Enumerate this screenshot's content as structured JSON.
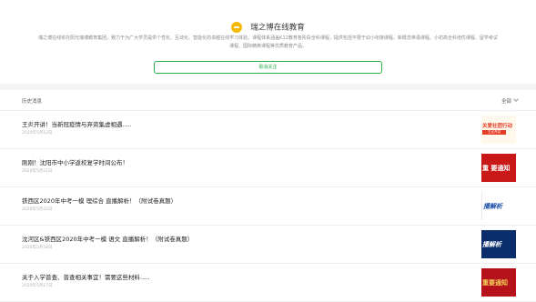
{
  "header": {
    "brand_icon": "bear-logo-icon",
    "brand_color": "#f5b90a",
    "brand_name": "瑞之博在线教育",
    "intro": "瑞之博在线依托阳光瑞博教育集团，致力于为广大学员提供个性化、互动化、智能化的卓越在线学习体验。课程体系涵盖K12教育各阶段全科课程，提供包括不限于幼小衔接课程、新概念英语课程、小初高全科培优课程、留学考试课程、国际精英课程等优质教育产品。",
    "follow_button": "取消关注",
    "accent_color": "#27b24b"
  },
  "history": {
    "title": "历史消息",
    "filter_label": "全部"
  },
  "articles": [
    {
      "title": "王炎开讲！当新冠疫情与弃资集虚相遇.....",
      "date": "2020年5月12日",
      "thumb_text": "关爱社团行动",
      "thumb_sub": "王炎开讲"
    },
    {
      "title": "刚刚！沈阳市中小学返校复学时间公布！",
      "date": "2020年5月21日",
      "thumb_text": "重 要通知"
    },
    {
      "title": "铁西区2020年中考一模 理综合 直播解析！（附试卷真题）",
      "date": "2020年5月22日",
      "thumb_text": "播解析"
    },
    {
      "title": "沈河区&铁西区2020年中考一模 语文 直播解析！（附试卷真题）",
      "date": "2020年5月18日",
      "thumb_text": "播解析"
    },
    {
      "title": "关于入学普查、普查相关事宜！需要这些材料.....",
      "date": "2020年5月17日",
      "thumb_text": "重要通知"
    }
  ]
}
